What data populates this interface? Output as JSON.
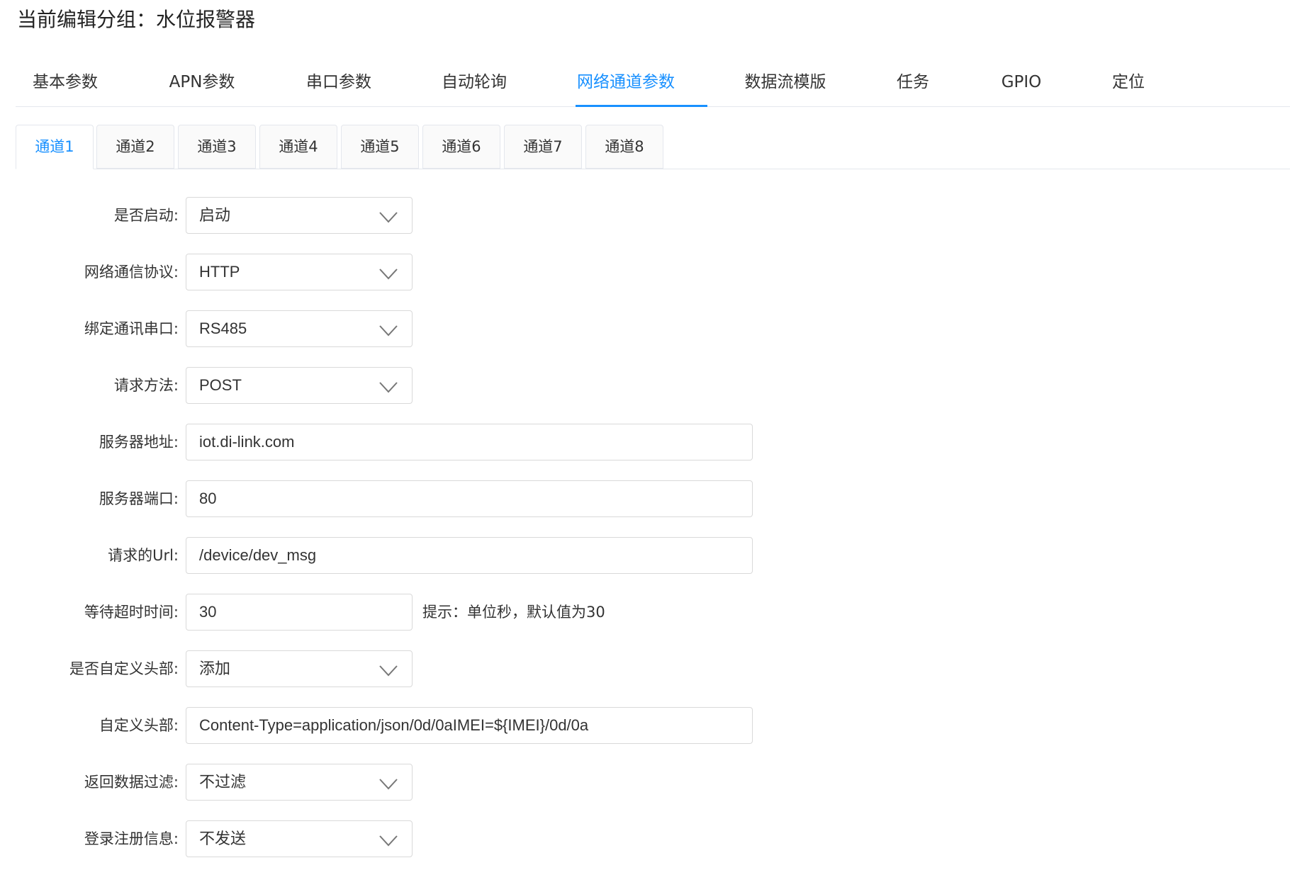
{
  "page": {
    "title": "当前编辑分组：水位报警器"
  },
  "main_tabs": [
    {
      "label": "基本参数"
    },
    {
      "label": "APN参数"
    },
    {
      "label": "串口参数"
    },
    {
      "label": "自动轮询"
    },
    {
      "label": "网络通道参数",
      "active": true
    },
    {
      "label": "数据流模版"
    },
    {
      "label": "任务"
    },
    {
      "label": "GPIO"
    },
    {
      "label": "定位"
    }
  ],
  "channel_tabs": [
    {
      "label": "通道1",
      "active": true
    },
    {
      "label": "通道2"
    },
    {
      "label": "通道3"
    },
    {
      "label": "通道4"
    },
    {
      "label": "通道5"
    },
    {
      "label": "通道6"
    },
    {
      "label": "通道7"
    },
    {
      "label": "通道8"
    }
  ],
  "form": {
    "enabled": {
      "label": "是否启动:",
      "value": "启动"
    },
    "protocol": {
      "label": "网络通信协议:",
      "value": "HTTP"
    },
    "serial_port": {
      "label": "绑定通讯串口:",
      "value": "RS485"
    },
    "method": {
      "label": "请求方法:",
      "value": "POST"
    },
    "server_address": {
      "label": "服务器地址:",
      "value": "iot.di-link.com"
    },
    "server_port": {
      "label": "服务器端口:",
      "value": "80"
    },
    "request_url": {
      "label": "请求的Url:",
      "value": "/device/dev_msg"
    },
    "timeout": {
      "label": "等待超时时间:",
      "value": "30",
      "hint": "提示：单位秒，默认值为30"
    },
    "custom_header_enabled": {
      "label": "是否自定义头部:",
      "value": "添加"
    },
    "custom_header": {
      "label": "自定义头部:",
      "value": "Content-Type=application/json/0d/0aIMEI=${IMEI}/0d/0a"
    },
    "response_filter": {
      "label": "返回数据过滤:",
      "value": "不过滤"
    },
    "login_info": {
      "label": "登录注册信息:",
      "value": "不发送"
    }
  },
  "theme": {
    "accent": "#1890ff",
    "text": "#333333",
    "border": "#d9d9d9"
  },
  "icons": {
    "dropdown": "chevron-down-icon"
  }
}
